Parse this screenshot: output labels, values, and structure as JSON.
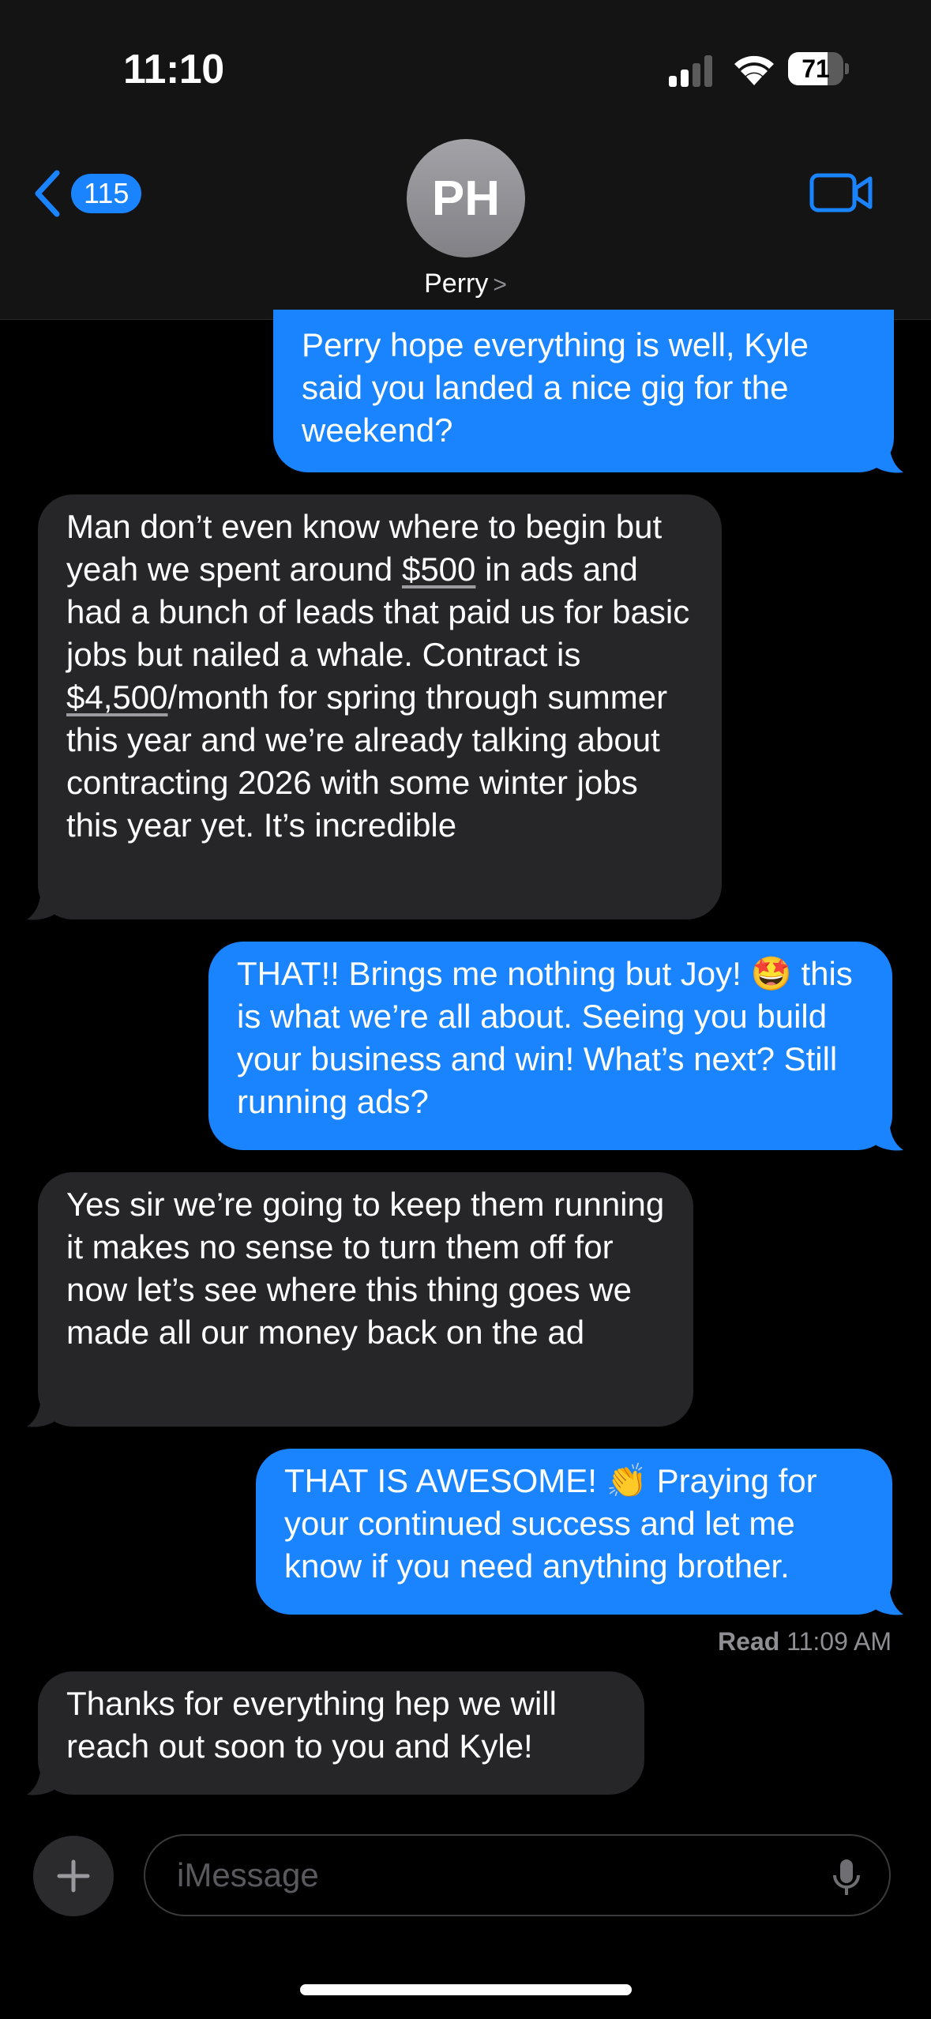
{
  "status_bar": {
    "time": "11:10",
    "battery_level": "71",
    "battery_fraction": 0.71
  },
  "header": {
    "back_count": "115",
    "avatar_initials": "PH",
    "contact_name": "Perry",
    "name_chevron": ">",
    "video_icon": "video-camera-icon"
  },
  "messages": [
    {
      "direction": "sent",
      "text": "Perry hope everything is well, Kyle said you landed a nice gig for the weekend?"
    },
    {
      "direction": "received",
      "parts": {
        "a": "Man don’t even know where to begin but yeah we spent around ",
        "b": "$500",
        "c": " in ads and had a bunch of leads that paid us for basic jobs but nailed a whale. Contract is ",
        "d": "$4,500",
        "e": "/month for spring through summer this year and we’re already talking about contracting 2026 with some winter jobs this year yet. It’s incredible"
      }
    },
    {
      "direction": "sent",
      "text": "THAT!! Brings me nothing but Joy! 🤩 this is what we’re all about. Seeing you build your business and win! What’s next? Still running ads?"
    },
    {
      "direction": "received",
      "text": "Yes sir we’re going to keep them running it makes no sense to turn them off for now let’s see where this thing goes we made all our money back on the ad"
    },
    {
      "direction": "sent",
      "text": "THAT IS AWESOME! 👏 Praying for your continued success and let me know if you need anything brother."
    },
    {
      "direction": "received",
      "text": "Thanks for everything hep we will reach out soon to you and Kyle!"
    }
  ],
  "read_receipt": {
    "label": "Read",
    "time": "11:09 AM"
  },
  "composer": {
    "placeholder": "iMessage",
    "plus_label": "+"
  },
  "colors": {
    "sent_bubble": "#1a84ff",
    "received_bubble": "#262629",
    "accent": "#1a84ff"
  }
}
